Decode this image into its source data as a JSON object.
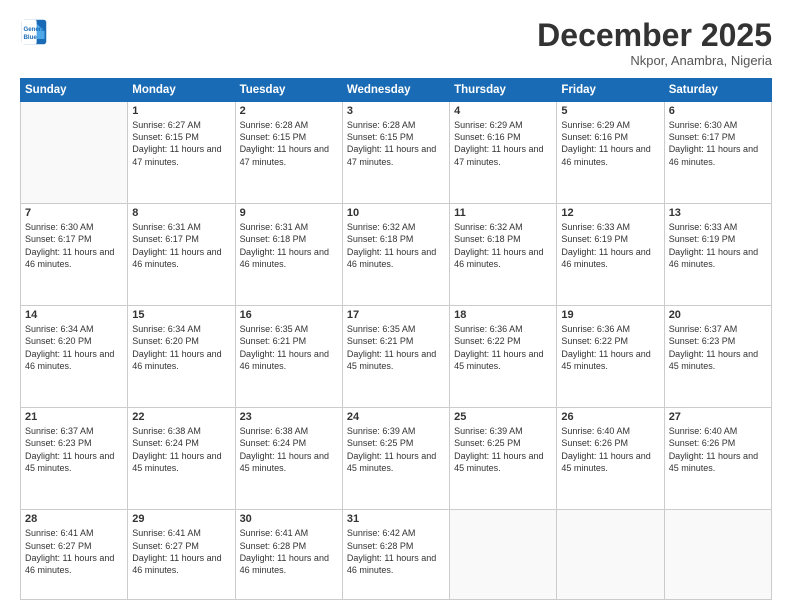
{
  "logo": {
    "line1": "General",
    "line2": "Blue"
  },
  "header": {
    "month": "December 2025",
    "location": "Nkpor, Anambra, Nigeria"
  },
  "weekdays": [
    "Sunday",
    "Monday",
    "Tuesday",
    "Wednesday",
    "Thursday",
    "Friday",
    "Saturday"
  ],
  "weeks": [
    [
      {
        "day": "",
        "info": ""
      },
      {
        "day": "1",
        "info": "Sunrise: 6:27 AM\nSunset: 6:15 PM\nDaylight: 11 hours and 47 minutes."
      },
      {
        "day": "2",
        "info": "Sunrise: 6:28 AM\nSunset: 6:15 PM\nDaylight: 11 hours and 47 minutes."
      },
      {
        "day": "3",
        "info": "Sunrise: 6:28 AM\nSunset: 6:15 PM\nDaylight: 11 hours and 47 minutes."
      },
      {
        "day": "4",
        "info": "Sunrise: 6:29 AM\nSunset: 6:16 PM\nDaylight: 11 hours and 47 minutes."
      },
      {
        "day": "5",
        "info": "Sunrise: 6:29 AM\nSunset: 6:16 PM\nDaylight: 11 hours and 46 minutes."
      },
      {
        "day": "6",
        "info": "Sunrise: 6:30 AM\nSunset: 6:17 PM\nDaylight: 11 hours and 46 minutes."
      }
    ],
    [
      {
        "day": "7",
        "info": "Sunrise: 6:30 AM\nSunset: 6:17 PM\nDaylight: 11 hours and 46 minutes."
      },
      {
        "day": "8",
        "info": "Sunrise: 6:31 AM\nSunset: 6:17 PM\nDaylight: 11 hours and 46 minutes."
      },
      {
        "day": "9",
        "info": "Sunrise: 6:31 AM\nSunset: 6:18 PM\nDaylight: 11 hours and 46 minutes."
      },
      {
        "day": "10",
        "info": "Sunrise: 6:32 AM\nSunset: 6:18 PM\nDaylight: 11 hours and 46 minutes."
      },
      {
        "day": "11",
        "info": "Sunrise: 6:32 AM\nSunset: 6:18 PM\nDaylight: 11 hours and 46 minutes."
      },
      {
        "day": "12",
        "info": "Sunrise: 6:33 AM\nSunset: 6:19 PM\nDaylight: 11 hours and 46 minutes."
      },
      {
        "day": "13",
        "info": "Sunrise: 6:33 AM\nSunset: 6:19 PM\nDaylight: 11 hours and 46 minutes."
      }
    ],
    [
      {
        "day": "14",
        "info": "Sunrise: 6:34 AM\nSunset: 6:20 PM\nDaylight: 11 hours and 46 minutes."
      },
      {
        "day": "15",
        "info": "Sunrise: 6:34 AM\nSunset: 6:20 PM\nDaylight: 11 hours and 46 minutes."
      },
      {
        "day": "16",
        "info": "Sunrise: 6:35 AM\nSunset: 6:21 PM\nDaylight: 11 hours and 46 minutes."
      },
      {
        "day": "17",
        "info": "Sunrise: 6:35 AM\nSunset: 6:21 PM\nDaylight: 11 hours and 45 minutes."
      },
      {
        "day": "18",
        "info": "Sunrise: 6:36 AM\nSunset: 6:22 PM\nDaylight: 11 hours and 45 minutes."
      },
      {
        "day": "19",
        "info": "Sunrise: 6:36 AM\nSunset: 6:22 PM\nDaylight: 11 hours and 45 minutes."
      },
      {
        "day": "20",
        "info": "Sunrise: 6:37 AM\nSunset: 6:23 PM\nDaylight: 11 hours and 45 minutes."
      }
    ],
    [
      {
        "day": "21",
        "info": "Sunrise: 6:37 AM\nSunset: 6:23 PM\nDaylight: 11 hours and 45 minutes."
      },
      {
        "day": "22",
        "info": "Sunrise: 6:38 AM\nSunset: 6:24 PM\nDaylight: 11 hours and 45 minutes."
      },
      {
        "day": "23",
        "info": "Sunrise: 6:38 AM\nSunset: 6:24 PM\nDaylight: 11 hours and 45 minutes."
      },
      {
        "day": "24",
        "info": "Sunrise: 6:39 AM\nSunset: 6:25 PM\nDaylight: 11 hours and 45 minutes."
      },
      {
        "day": "25",
        "info": "Sunrise: 6:39 AM\nSunset: 6:25 PM\nDaylight: 11 hours and 45 minutes."
      },
      {
        "day": "26",
        "info": "Sunrise: 6:40 AM\nSunset: 6:26 PM\nDaylight: 11 hours and 45 minutes."
      },
      {
        "day": "27",
        "info": "Sunrise: 6:40 AM\nSunset: 6:26 PM\nDaylight: 11 hours and 45 minutes."
      }
    ],
    [
      {
        "day": "28",
        "info": "Sunrise: 6:41 AM\nSunset: 6:27 PM\nDaylight: 11 hours and 46 minutes."
      },
      {
        "day": "29",
        "info": "Sunrise: 6:41 AM\nSunset: 6:27 PM\nDaylight: 11 hours and 46 minutes."
      },
      {
        "day": "30",
        "info": "Sunrise: 6:41 AM\nSunset: 6:28 PM\nDaylight: 11 hours and 46 minutes."
      },
      {
        "day": "31",
        "info": "Sunrise: 6:42 AM\nSunset: 6:28 PM\nDaylight: 11 hours and 46 minutes."
      },
      {
        "day": "",
        "info": ""
      },
      {
        "day": "",
        "info": ""
      },
      {
        "day": "",
        "info": ""
      }
    ]
  ]
}
